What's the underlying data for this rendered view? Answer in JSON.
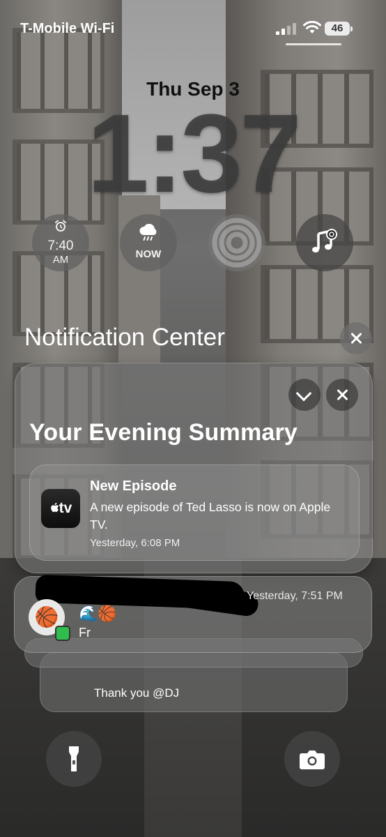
{
  "status_bar": {
    "carrier": "T-Mobile Wi-Fi",
    "battery": "46"
  },
  "lock_screen": {
    "date": "Thu Sep 3",
    "time": "1:37"
  },
  "widgets": {
    "alarm_time": "7:40",
    "alarm_period": "AM",
    "weather_label": "NOW"
  },
  "notification_center": {
    "title": "Notification Center"
  },
  "summary": {
    "title": "Your Evening Summary",
    "episode": {
      "app_icon_text": "tv",
      "title": "New Episode",
      "body": "A new episode of Ted Lasso is now on Apple TV.",
      "time": "Yesterday, 6:08 PM"
    }
  },
  "message": {
    "time": "Yesterday, 7:51 PM",
    "emoji_line": "🌊🏀",
    "text": "Fr",
    "avatar_emoji": "🏀"
  },
  "stacked_message": {
    "text": "Thank you @DJ"
  }
}
